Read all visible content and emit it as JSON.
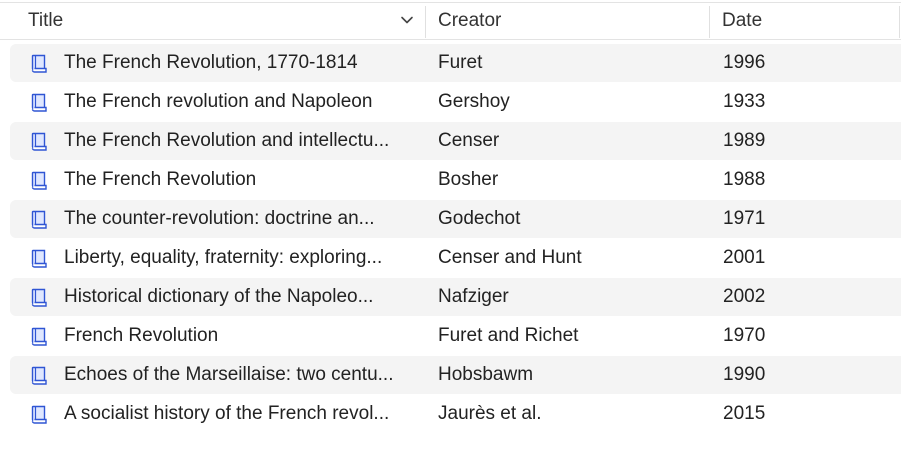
{
  "columns": {
    "title": "Title",
    "creator": "Creator",
    "date": "Date"
  },
  "sort_icon": "chevron-down-icon",
  "row_icon": "book-icon",
  "accent_color": "#2f55d4",
  "rows": [
    {
      "title": "The French Revolution, 1770-1814",
      "creator": "Furet",
      "date": "1996"
    },
    {
      "title": "The French revolution and Napoleon",
      "creator": "Gershoy",
      "date": "1933"
    },
    {
      "title": "The French Revolution and intellectu...",
      "creator": "Censer",
      "date": "1989"
    },
    {
      "title": "The French Revolution",
      "creator": "Bosher",
      "date": "1988"
    },
    {
      "title": "The counter-revolution: doctrine an...",
      "creator": "Godechot",
      "date": "1971"
    },
    {
      "title": "Liberty, equality, fraternity: exploring...",
      "creator": "Censer and Hunt",
      "date": "2001"
    },
    {
      "title": "Historical dictionary of the Napoleo...",
      "creator": "Nafziger",
      "date": "2002"
    },
    {
      "title": "French Revolution",
      "creator": "Furet and Richet",
      "date": "1970"
    },
    {
      "title": "Echoes of the Marseillaise: two centu...",
      "creator": "Hobsbawm",
      "date": "1990"
    },
    {
      "title": "A socialist history of the French revol...",
      "creator": "Jaurès et al.",
      "date": "2015"
    }
  ]
}
